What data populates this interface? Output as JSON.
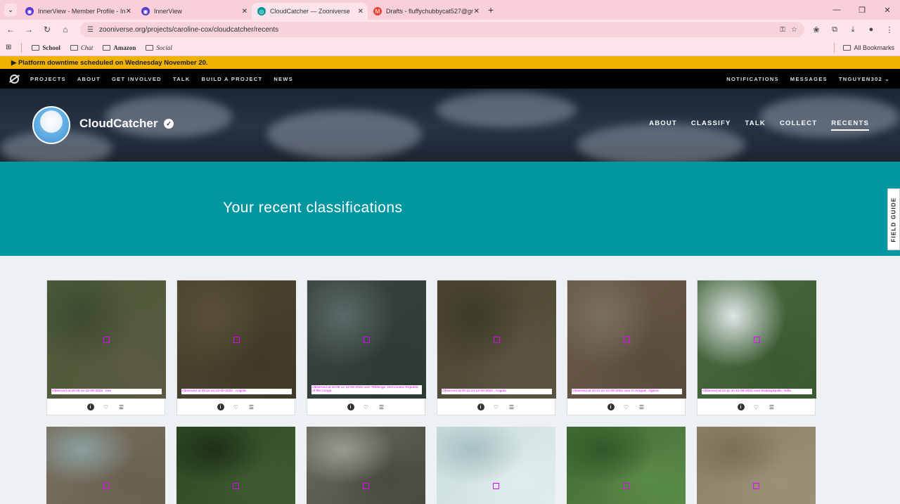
{
  "browser": {
    "tabs": [
      {
        "title": "InnerView - Member Profile - In",
        "icon": "innerview-icon",
        "active": false
      },
      {
        "title": "InnerView",
        "icon": "innerview-icon",
        "active": false
      },
      {
        "title": "CloudCatcher — Zooniverse",
        "icon": "zooniverse-icon",
        "active": true
      },
      {
        "title": "Drafts - fluffychubbycat527@gr",
        "icon": "gmail-icon",
        "active": false
      }
    ],
    "url": "zooniverse.org/projects/caroline-cox/cloudcatcher/recents",
    "bookmarks": [
      "School",
      "Chat",
      "Amazon",
      "Social"
    ],
    "all_bookmarks": "All Bookmarks"
  },
  "announcement": "▶ Platform downtime scheduled on Wednesday November 20.",
  "zoo_nav": {
    "left": [
      "PROJECTS",
      "ABOUT",
      "GET INVOLVED",
      "TALK",
      "BUILD A PROJECT",
      "NEWS"
    ],
    "right": [
      "NOTIFICATIONS",
      "MESSAGES",
      "TNGUYEN302 ⌄"
    ]
  },
  "project": {
    "name": "CloudCatcher",
    "nav": [
      "ABOUT",
      "CLASSIFY",
      "TALK",
      "COLLECT",
      "RECENTS"
    ],
    "active_nav": "RECENTS"
  },
  "page_title": "Your recent classifications",
  "field_guide": "FIELD GUIDE",
  "classifications": [
    {
      "caption": "Observed at 10:46 on 12-08-2022 , Iran",
      "colors": [
        "#4a5a38",
        "#3e4a30",
        "#5a5a40"
      ]
    },
    {
      "caption": "Observed at 09:12 on 12-08-2022 , Angola",
      "colors": [
        "#4e4630",
        "#5a5038",
        "#403a28"
      ]
    },
    {
      "caption": "Observed at 10:09 on 12-08-2022 over Tshilenge, Democratic Republic of the Congo",
      "colors": [
        "#3a4440",
        "#5a6a68",
        "#2e3a34"
      ]
    },
    {
      "caption": "Observed at 09:12 on 12-08-2022 , Angola",
      "colors": [
        "#4a4630",
        "#3e3a2a",
        "#5a5440"
      ]
    },
    {
      "caption": "Observed at 10:41 on 12-08-2022 over In Amguel, Algeria",
      "colors": [
        "#6a5a48",
        "#7a7060",
        "#5a4c3c"
      ]
    },
    {
      "caption": "Observed at 10:11 on 12-08-2022 over Buddayapalle, India",
      "colors": [
        "#4a6a40",
        "#dfe6e8",
        "#3a5a30"
      ]
    }
  ],
  "second_row": [
    {
      "colors": [
        "#7a7060",
        "#8aa0a0",
        "#6a6050"
      ]
    },
    {
      "colors": [
        "#2e4a24",
        "#1e3018",
        "#3e5a30"
      ]
    },
    {
      "colors": [
        "#6a6a60",
        "#9a9a90",
        "#4a4a40"
      ]
    },
    {
      "colors": [
        "#c8dcdc",
        "#a8c0c0",
        "#e0ecec"
      ]
    },
    {
      "colors": [
        "#3e6a34",
        "#2e5a28",
        "#5a8a48"
      ]
    },
    {
      "colors": [
        "#8a8068",
        "#7a7058",
        "#9a9078"
      ]
    }
  ]
}
